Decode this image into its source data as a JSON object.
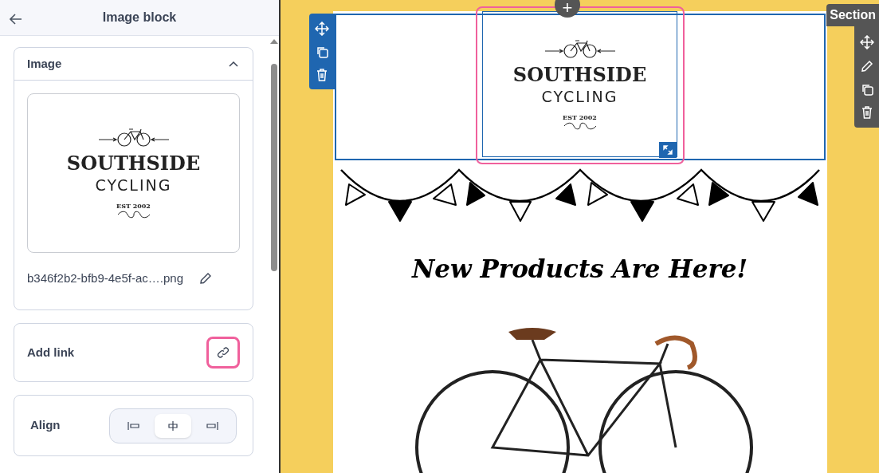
{
  "panel": {
    "title": "Image block"
  },
  "image_section": {
    "title": "Image",
    "expanded": true,
    "logo": {
      "top": "SOUTHSIDE",
      "middle": "CYCLING",
      "bottom": "EST 2002"
    },
    "filename": "b346f2b2-bfb9-4e5f-ac….png"
  },
  "link_section": {
    "label": "Add link",
    "highlighted": true
  },
  "align_section": {
    "label": "Align",
    "options": [
      {
        "kind": "left",
        "selected": false
      },
      {
        "kind": "center",
        "selected": true
      },
      {
        "kind": "right",
        "selected": false
      }
    ]
  },
  "canvas": {
    "section_label": "Section",
    "add_button": "+",
    "logo": {
      "top": "SOUTHSIDE",
      "middle": "CYCLING",
      "bottom": "EST 2002"
    },
    "image_highlighted": true,
    "heading": "New Products Are Here!"
  }
}
